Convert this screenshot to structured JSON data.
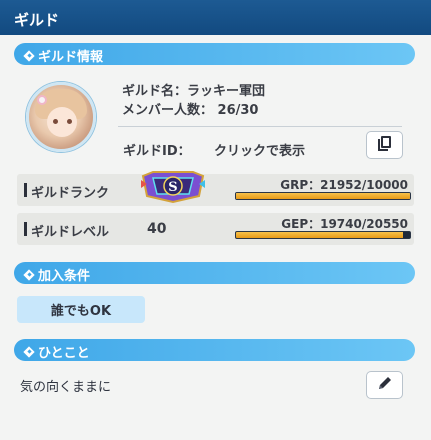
{
  "window": {
    "title": "ギルド"
  },
  "sections": {
    "info": "ギルド情報",
    "conditions": "加入条件",
    "comment": "ひとこと"
  },
  "guild": {
    "name_line": "ギルド名：ラッキー軍団",
    "members_line": "メンバー人数： 26/30",
    "id_label": "ギルドID：",
    "id_link": "クリックで表示"
  },
  "rank": {
    "label": "ギルドランク",
    "badge_letter": "S",
    "grp_text": "GRP：21952/10000",
    "grp_fill": 1.0
  },
  "level": {
    "label": "ギルドレベル",
    "value": "40",
    "gep_text": "GEP：19740/20550",
    "gep_fill": 0.9606
  },
  "conditions": {
    "chip": "誰でもOK"
  },
  "comment": {
    "text": "気の向くままに"
  },
  "icons": {
    "copy": "copy-icon",
    "edit": "pencil-icon",
    "section": "diamond-icon"
  },
  "colors": {
    "titlebar": "#124a80",
    "section_bar": "#3fa7e8",
    "progress": "#f0ad2c",
    "chip": "#c8e7fb"
  }
}
